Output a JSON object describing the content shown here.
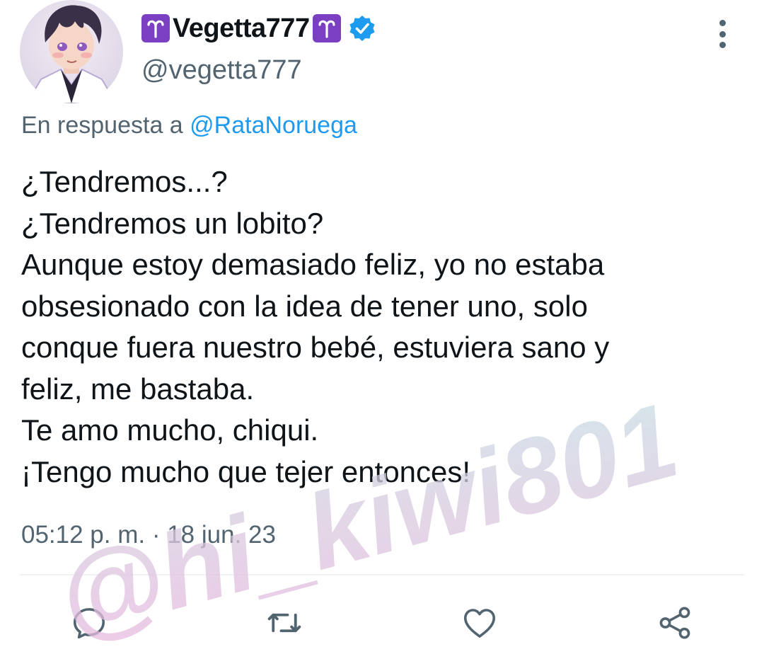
{
  "tweet": {
    "display_name": "Vegetta777",
    "name_emoji": "aries-sign-icon",
    "verified": true,
    "handle": "@vegetta777",
    "reply_prefix": "En respuesta a",
    "reply_mention": "@RataNoruega",
    "lines": [
      "¿Tendremos...?",
      "¿Tendremos un lobito?",
      "Aunque estoy demasiado feliz, yo no estaba",
      "obsesionado con la idea de tener uno, solo",
      "conque fuera nuestro bebé, estuviera sano y",
      "feliz, me bastaba.",
      "Te amo mucho, chiqui.",
      "¡Tengo mucho que tejer entonces!"
    ],
    "timestamp": "05:12 p. m. · 18 jun. 23"
  },
  "watermark": "@hi_kiwi801",
  "actions": [
    "reply-icon",
    "retweet-icon",
    "like-icon",
    "share-icon"
  ],
  "colors": {
    "text": "#0f1419",
    "secondary": "#536471",
    "link": "#1d9bf0",
    "verified": "#1d9bf0",
    "aries_bg": "#7a3fc2"
  }
}
